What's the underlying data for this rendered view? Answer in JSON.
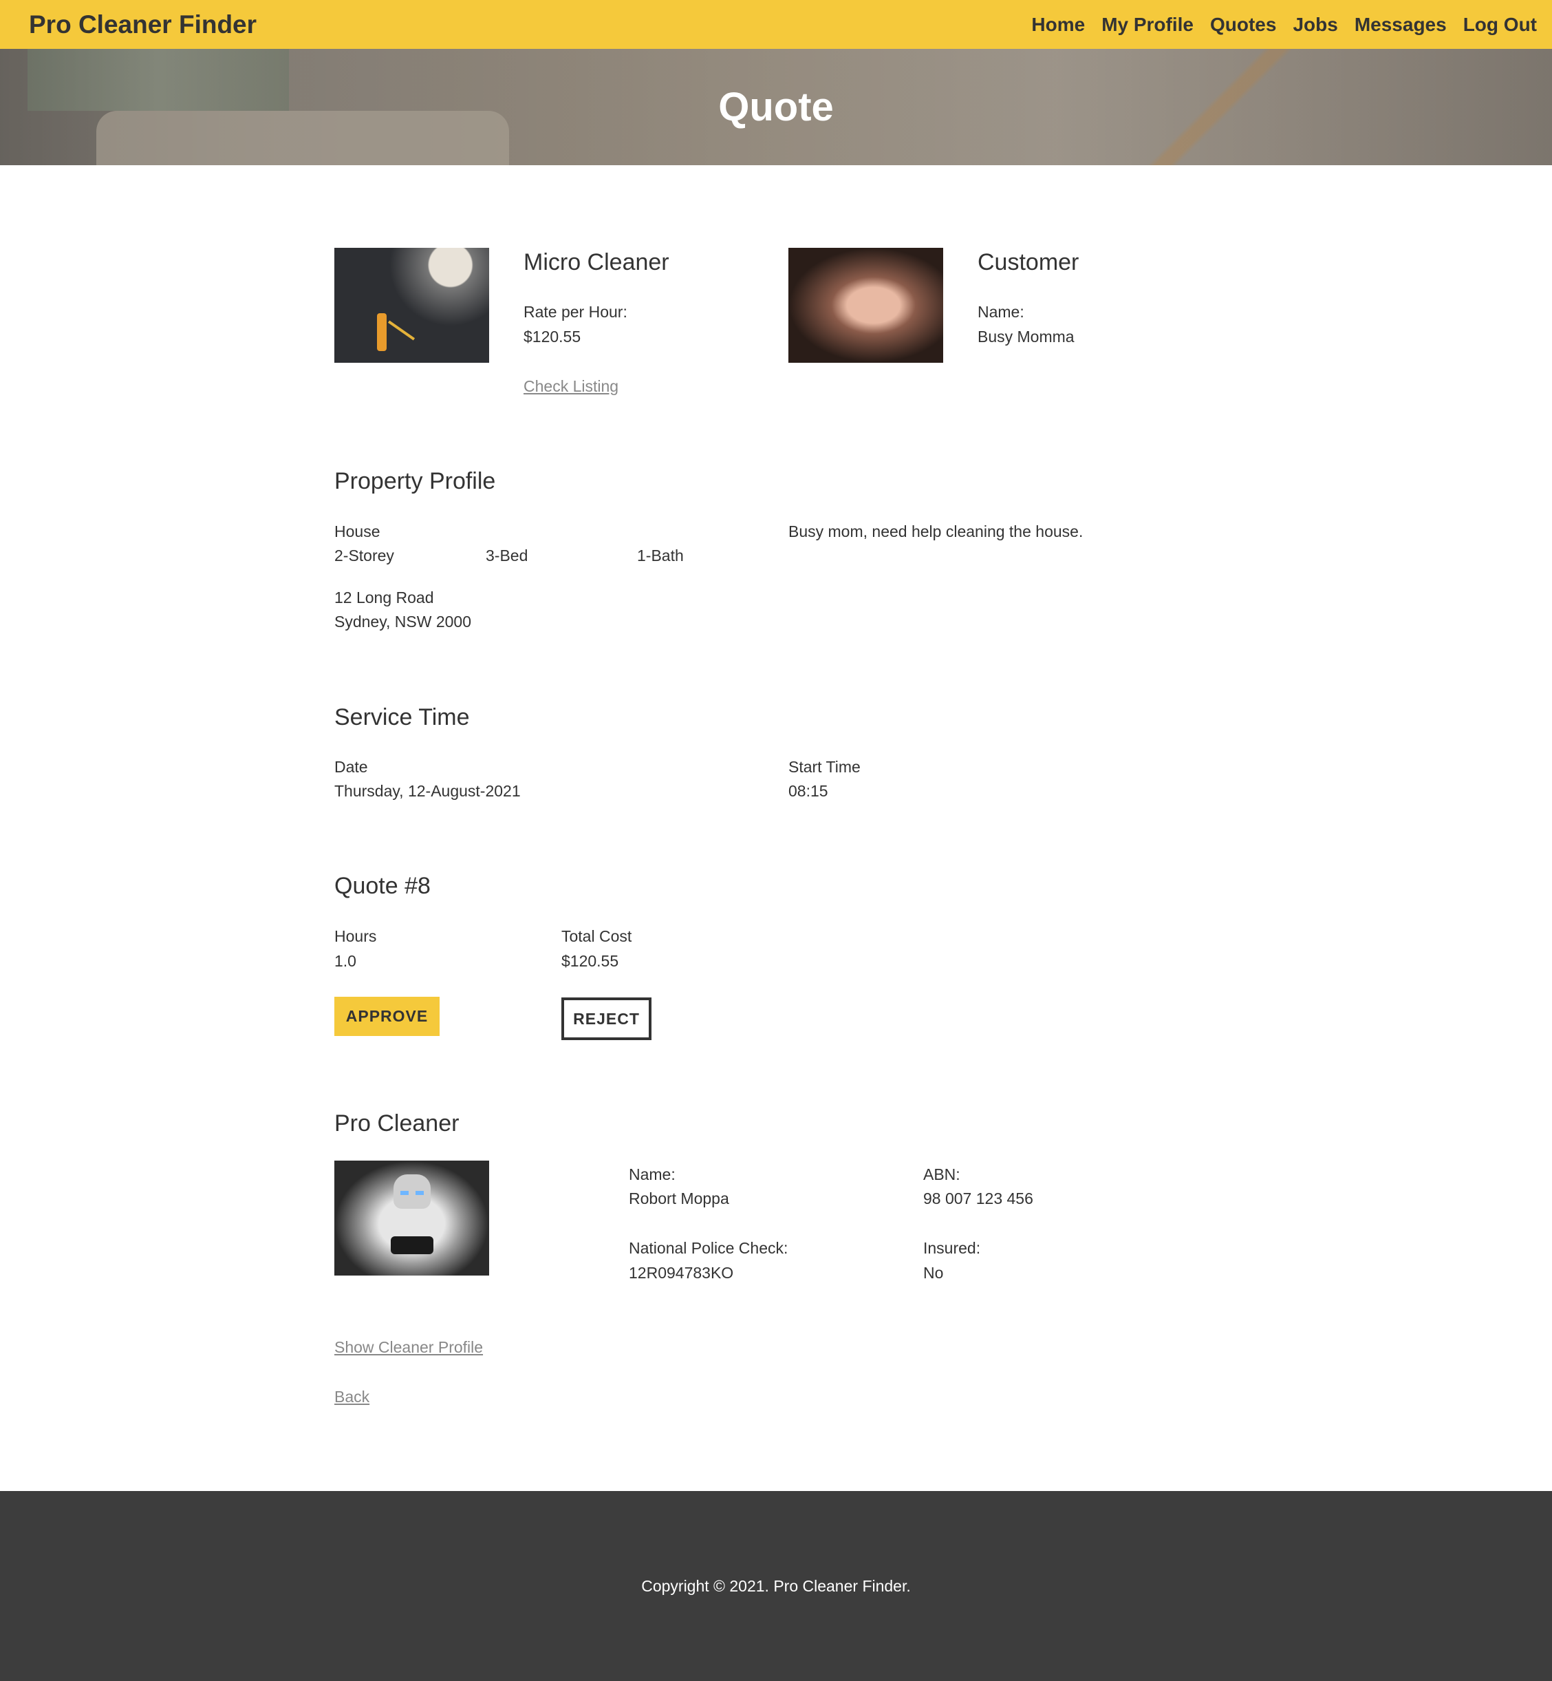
{
  "nav": {
    "brand": "Pro Cleaner Finder",
    "links": [
      "Home",
      "My Profile",
      "Quotes",
      "Jobs",
      "Messages",
      "Log Out"
    ]
  },
  "hero": {
    "title": "Quote"
  },
  "listing": {
    "title": "Micro Cleaner",
    "rate_label": "Rate per Hour:",
    "rate_value": "$120.55",
    "check_link": "Check Listing"
  },
  "customer": {
    "title": "Customer",
    "name_label": "Name:",
    "name_value": "Busy Momma"
  },
  "property": {
    "title": "Property Profile",
    "type": "House",
    "storeys": "2-Storey",
    "beds": "3-Bed",
    "baths": "1-Bath",
    "address_line1": "12 Long Road",
    "address_line2": "Sydney, NSW 2000",
    "description": "Busy mom, need help cleaning the house."
  },
  "service": {
    "title": "Service Time",
    "date_label": "Date",
    "date_value": "Thursday, 12-August-2021",
    "start_label": "Start Time",
    "start_value": "08:15"
  },
  "quote": {
    "title": "Quote #8",
    "hours_label": "Hours",
    "hours_value": "1.0",
    "cost_label": "Total Cost",
    "cost_value": "$120.55",
    "approve": "APPROVE",
    "reject": "REJECT"
  },
  "cleaner": {
    "title": "Pro Cleaner",
    "name_label": "Name:",
    "name_value": "Robort Moppa",
    "abn_label": "ABN:",
    "abn_value": "98 007 123 456",
    "police_label": "National Police Check:",
    "police_value": "12R094783KO",
    "insured_label": "Insured:",
    "insured_value": "No",
    "profile_link": "Show Cleaner Profile",
    "back_link": "Back"
  },
  "footer": {
    "copyright": "Copyright © 2021. Pro Cleaner Finder."
  },
  "colors": {
    "accent": "#f5c93b",
    "footer_bg": "#3d3d3d",
    "text": "#333333"
  }
}
